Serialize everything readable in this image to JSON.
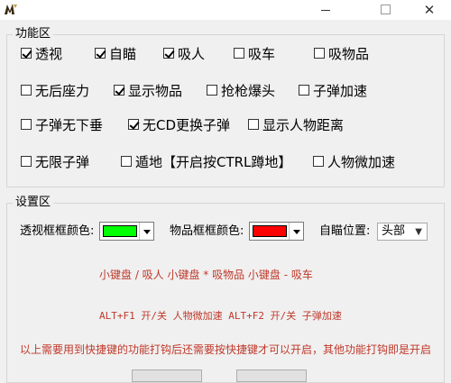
{
  "features": {
    "title": "功能区",
    "items": [
      {
        "label": "透视",
        "checked": true
      },
      {
        "label": "自瞄",
        "checked": true
      },
      {
        "label": "吸人",
        "checked": true
      },
      {
        "label": "吸车",
        "checked": false
      },
      {
        "label": "吸物品",
        "checked": false
      },
      {
        "label": "无后座力",
        "checked": false
      },
      {
        "label": "显示物品",
        "checked": true
      },
      {
        "label": "抢枪爆头",
        "checked": false
      },
      {
        "label": "子弹加速",
        "checked": false
      },
      {
        "label": "子弹无下垂",
        "checked": false
      },
      {
        "label": "无CD更换子弹",
        "checked": true
      },
      {
        "label": "显示人物距离",
        "checked": false
      },
      {
        "label": "无限子弹",
        "checked": false
      },
      {
        "label": "遁地【开启按CTRL蹲地】",
        "checked": false
      },
      {
        "label": "人物微加速",
        "checked": false
      }
    ]
  },
  "settings": {
    "title": "设置区",
    "perspective_color_label": "透视框框颜色:",
    "perspective_color": "#00ff00",
    "item_color_label": "物品框框颜色:",
    "item_color": "#ff0000",
    "aim_position_label": "自瞄位置:",
    "aim_position_value": "头部",
    "hotkey_line1": "小键盘 / 吸人   小键盘 * 吸物品  小键盘 - 吸车",
    "hotkey_line2": "ALT+F1 开/关 人物微加速  ALT+F2 开/关 子弹加速",
    "notice": "以上需要用到快捷键的功能打钩后还需要按快捷键才可以开启，其他功能打钩即是开启"
  },
  "colors": {
    "accent_text": "#c0392b"
  }
}
